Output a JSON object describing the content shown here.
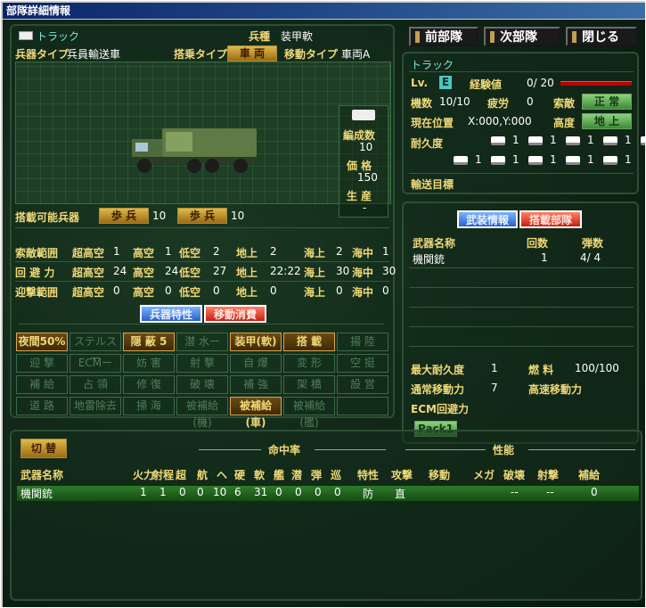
{
  "window_title": "部隊詳細情報",
  "top_buttons": [
    "前部隊",
    "次部隊",
    "閉じる"
  ],
  "unit": {
    "icon": "truck-icon",
    "name": "トラック",
    "branch_label": "兵種",
    "branch": "装甲軟",
    "weapon_type_label": "兵器タイプ",
    "weapon_type": "兵員輸送車",
    "board_type_label": "搭乗タイプ",
    "board_type": "車 両",
    "move_type_label": "移動タイプ",
    "move_type": "車両A",
    "formation_label": "編成数",
    "formation": "10",
    "price_label": "価 格",
    "price": "150",
    "production_label": "生 産",
    "production": "-",
    "carry_label": "搭載可能兵器",
    "carry": [
      {
        "name": "歩 兵",
        "value": "10"
      },
      {
        "name": "歩 兵",
        "value": "10"
      }
    ]
  },
  "ranges": [
    {
      "label": "索敵範囲",
      "values": [
        {
          "k": "超高空",
          "v": "1"
        },
        {
          "k": "高空",
          "v": "1"
        },
        {
          "k": "低空",
          "v": "2"
        },
        {
          "k": "地上",
          "v": "2"
        },
        {
          "k": "海上",
          "v": "2"
        },
        {
          "k": "海中",
          "v": "1"
        }
      ]
    },
    {
      "label": "回 避 力",
      "values": [
        {
          "k": "超高空",
          "v": "24"
        },
        {
          "k": "高空",
          "v": "24"
        },
        {
          "k": "低空",
          "v": "27"
        },
        {
          "k": "地上",
          "v": "22:22"
        },
        {
          "k": "海上",
          "v": "30"
        },
        {
          "k": "海中",
          "v": "30"
        }
      ]
    },
    {
      "label": "迎撃範囲",
      "values": [
        {
          "k": "超高空",
          "v": "0"
        },
        {
          "k": "高空",
          "v": "0"
        },
        {
          "k": "低空",
          "v": "0"
        },
        {
          "k": "地上",
          "v": "0"
        },
        {
          "k": "海上",
          "v": "0"
        },
        {
          "k": "海中",
          "v": "0"
        }
      ]
    }
  ],
  "trait_tabs": [
    "兵器特性",
    "移動消費"
  ],
  "traits": [
    [
      {
        "t": "夜間50%",
        "on": true
      },
      {
        "t": "ステルスー",
        "on": false
      },
      {
        "t": "隠 蔽 5",
        "on": true
      },
      {
        "t": "潜 水ー",
        "on": false
      },
      {
        "t": "装甲(軟)",
        "on": true
      },
      {
        "t": "搭 載",
        "on": true
      },
      {
        "t": "揚 陸",
        "on": false
      }
    ],
    [
      {
        "t": "迎 撃",
        "on": false
      },
      {
        "t": "ECMー",
        "on": false
      },
      {
        "t": "妨 害",
        "on": false
      },
      {
        "t": "射 撃",
        "on": false
      },
      {
        "t": "自 爆",
        "on": false
      },
      {
        "t": "変 形",
        "on": false
      },
      {
        "t": "空 挺",
        "on": false
      }
    ],
    [
      {
        "t": "補 給",
        "on": false
      },
      {
        "t": "占 領",
        "on": false
      },
      {
        "t": "修 復",
        "on": false
      },
      {
        "t": "破 壊",
        "on": false
      },
      {
        "t": "補 強",
        "on": false
      },
      {
        "t": "架 橋",
        "on": false
      },
      {
        "t": "設 営",
        "on": false
      }
    ],
    [
      {
        "t": "道 路",
        "on": false
      },
      {
        "t": "地雷除去",
        "on": false
      },
      {
        "t": "掃 海",
        "on": false
      },
      {
        "t": "被補給(機)",
        "on": false
      },
      {
        "t": "被補給(車)",
        "on": true
      },
      {
        "t": "被補給(艦)",
        "on": false
      },
      {
        "t": "",
        "on": false
      }
    ]
  ],
  "status": {
    "name": "トラック",
    "lv_label": "Lv.",
    "lv": "E",
    "exp_label": "経験値",
    "exp": "0/ 20",
    "units_label": "機数",
    "units": "10/10",
    "fatigue_label": "疲労",
    "fatigue": "0",
    "morale_label": "索敵",
    "morale": "正 常",
    "pos_label": "現在位置",
    "pos": "X:000,Y:000",
    "alt_label": "高度",
    "alt": "地 上",
    "dur_label": "耐久度",
    "dur": [
      "1",
      "1",
      "1",
      "1",
      "1",
      "1",
      "1",
      "1",
      "1",
      "1"
    ],
    "cargo_label": "輸送目標"
  },
  "arms_tabs": [
    "武装情報",
    "搭載部隊"
  ],
  "arms": {
    "headers": [
      "武器名称",
      "回数",
      "弾数"
    ],
    "rows": [
      {
        "name": "機関銃",
        "count": "1",
        "ammo": "4/ 4"
      }
    ]
  },
  "stats": {
    "max_dur_label": "最大耐久度",
    "max_dur": "1",
    "fuel_label": "燃 料",
    "fuel": "100/100",
    "move_label": "通常移動力",
    "move": "7",
    "fast_label": "高速移動力",
    "fast": "",
    "ecm_label": "ECM回避力",
    "pack": "Pack1"
  },
  "bottom": {
    "switch": "切 替",
    "hit_group": "命中率",
    "perf_group": "性能",
    "headers": [
      "武器名称",
      "火力",
      "射程",
      "超",
      "航",
      "ヘ",
      "硬",
      "軟",
      "艦",
      "潜",
      "弾",
      "巡",
      "特性",
      "攻撃",
      "移動",
      "メガ",
      "破壊",
      "射撃",
      "補給"
    ],
    "row": [
      "機関銃",
      "1",
      "1",
      "0",
      "0",
      "10",
      "6",
      "31",
      "0",
      "0",
      "0",
      "0",
      "防",
      "直",
      "",
      "",
      "--",
      "--",
      "0"
    ]
  }
}
